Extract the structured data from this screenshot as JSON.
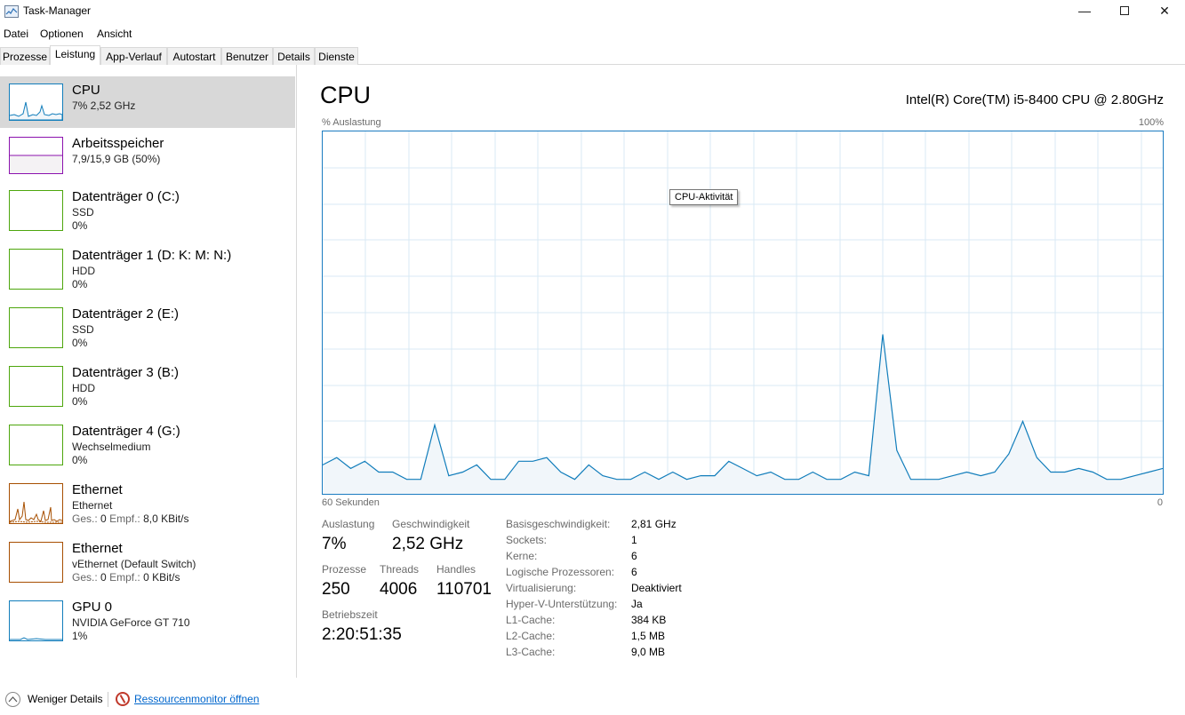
{
  "window": {
    "title": "Task-Manager",
    "minimize_glyph": "—",
    "close_glyph": "✕"
  },
  "menu": [
    "Datei",
    "Optionen",
    "Ansicht"
  ],
  "tabs": [
    "Prozesse",
    "Leistung",
    "App-Verlauf",
    "Autostart",
    "Benutzer",
    "Details",
    "Dienste"
  ],
  "active_tab": "Leistung",
  "resources": [
    {
      "title": "CPU",
      "lines": [
        "7% 2,52 GHz"
      ],
      "color": "#117dbb"
    },
    {
      "title": "Arbeitsspeicher",
      "lines": [
        "7,9/15,9 GB (50%)"
      ],
      "color": "#8b12ae"
    },
    {
      "title": "Datenträger 0 (C:)",
      "lines": [
        "SSD",
        "0%"
      ],
      "color": "#4da60c"
    },
    {
      "title": "Datenträger 1 (D: K: M: N:)",
      "lines": [
        "HDD",
        "0%"
      ],
      "color": "#4da60c"
    },
    {
      "title": "Datenträger 2 (E:)",
      "lines": [
        "SSD",
        "0%"
      ],
      "color": "#4da60c"
    },
    {
      "title": "Datenträger 3 (B:)",
      "lines": [
        "HDD",
        "0%"
      ],
      "color": "#4da60c"
    },
    {
      "title": "Datenträger 4 (G:)",
      "lines": [
        "Wechselmedium",
        "0%"
      ],
      "color": "#4da60c"
    },
    {
      "title": "Ethernet",
      "lines": [
        "Ethernet"
      ],
      "net": {
        "send_label": "Ges.:",
        "send": "0",
        "recv_label": "Empf.:",
        "recv": "8,0 KBit/s"
      },
      "color": "#a74f01"
    },
    {
      "title": "Ethernet",
      "lines": [
        "vEthernet (Default Switch)"
      ],
      "net": {
        "send_label": "Ges.:",
        "send": "0",
        "recv_label": "Empf.:",
        "recv": "0 KBit/s"
      },
      "color": "#a74f01"
    },
    {
      "title": "GPU 0",
      "lines": [
        "NVIDIA GeForce GT 710",
        "1%"
      ],
      "color": "#117dbb"
    }
  ],
  "detail": {
    "title": "CPU",
    "model": "Intel(R) Core(TM) i5-8400 CPU @ 2.80GHz",
    "y_label": "% Auslastung",
    "y_max_label": "100%",
    "x_left_label": "60 Sekunden",
    "x_right_label": "0",
    "tooltip": "CPU-Aktivität"
  },
  "chart_data": {
    "type": "area",
    "title": "",
    "xlabel": "",
    "ylabel": "% Auslastung",
    "ylim": [
      0,
      100
    ],
    "xlim": [
      60,
      0
    ],
    "grid": true,
    "x": [
      60,
      59,
      58,
      57,
      56,
      55,
      54,
      53,
      52,
      51,
      50,
      49,
      48,
      47,
      46,
      45,
      44,
      43,
      42,
      41,
      40,
      39,
      38,
      37,
      36,
      35,
      34,
      33,
      32,
      31,
      30,
      29,
      28,
      27,
      26,
      25,
      24,
      23,
      22,
      21,
      20,
      19,
      18,
      17,
      16,
      15,
      14,
      13,
      12,
      11,
      10,
      9,
      8,
      7,
      6,
      5,
      4,
      3,
      2,
      1,
      0
    ],
    "values": [
      8,
      10,
      7,
      9,
      6,
      6,
      4,
      4,
      19,
      5,
      6,
      8,
      4,
      4,
      9,
      9,
      10,
      6,
      4,
      8,
      5,
      4,
      4,
      6,
      4,
      6,
      4,
      5,
      5,
      9,
      7,
      5,
      6,
      4,
      4,
      6,
      4,
      4,
      6,
      5,
      44,
      12,
      4,
      4,
      4,
      5,
      6,
      5,
      6,
      11,
      20,
      10,
      6,
      6,
      7,
      6,
      4,
      4,
      5,
      6,
      7
    ]
  },
  "stats": {
    "auslastung": {
      "label": "Auslastung",
      "value": "7%"
    },
    "geschwindigkeit": {
      "label": "Geschwindigkeit",
      "value": "2,52 GHz"
    },
    "prozesse": {
      "label": "Prozesse",
      "value": "250"
    },
    "threads": {
      "label": "Threads",
      "value": "4006"
    },
    "handles": {
      "label": "Handles",
      "value": "110701"
    },
    "betriebszeit": {
      "label": "Betriebszeit",
      "value": "2:20:51:35"
    }
  },
  "info": [
    {
      "label": "Basisgeschwindigkeit:",
      "value": "2,81 GHz"
    },
    {
      "label": "Sockets:",
      "value": "1"
    },
    {
      "label": "Kerne:",
      "value": "6"
    },
    {
      "label": "Logische Prozessoren:",
      "value": "6"
    },
    {
      "label": "Virtualisierung:",
      "value": "Deaktiviert"
    },
    {
      "label": "Hyper-V-Unterstützung:",
      "value": "Ja"
    },
    {
      "label": "L1-Cache:",
      "value": "384 KB"
    },
    {
      "label": "L2-Cache:",
      "value": "1,5 MB"
    },
    {
      "label": "L3-Cache:",
      "value": "9,0 MB"
    }
  ],
  "footer": {
    "fewer_details": "Weniger Details",
    "resource_monitor": "Ressourcenmonitor öffnen"
  },
  "colors": {
    "cpu_line": "#117dbb",
    "cpu_fill": "#f1f6fa",
    "grid": "#d9eaf4"
  }
}
